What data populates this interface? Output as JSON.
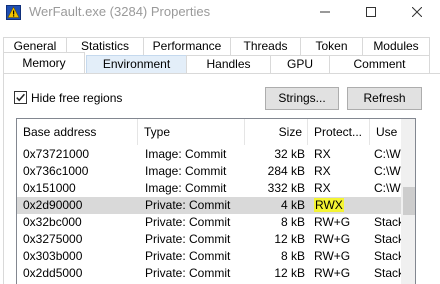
{
  "window": {
    "title": "WerFault.exe (3284) Properties",
    "icon": "werfault-app-icon",
    "controls": {
      "minimize": "minimize-icon",
      "maximize": "maximize-icon",
      "close": "close-icon"
    }
  },
  "tabs": {
    "row1": [
      {
        "label": "General"
      },
      {
        "label": "Statistics"
      },
      {
        "label": "Performance"
      },
      {
        "label": "Threads"
      },
      {
        "label": "Token"
      },
      {
        "label": "Modules"
      }
    ],
    "row2": [
      {
        "label": "Memory",
        "active": true
      },
      {
        "label": "Environment",
        "highlight": true
      },
      {
        "label": "Handles"
      },
      {
        "label": "GPU"
      },
      {
        "label": "Comment"
      }
    ]
  },
  "options": {
    "hide_free_label": "Hide free regions",
    "hide_free_checked": true
  },
  "buttons": {
    "strings": "Strings...",
    "refresh": "Refresh"
  },
  "list": {
    "columns": [
      "Base address",
      "Type",
      "Size",
      "Protect...",
      "Use"
    ],
    "rows": [
      {
        "addr": "0x73721000",
        "type": "Image: Commit",
        "size": "32 kB",
        "protect": "RX",
        "use": "C:\\W"
      },
      {
        "addr": "0x736c1000",
        "type": "Image: Commit",
        "size": "284 kB",
        "protect": "RX",
        "use": "C:\\W"
      },
      {
        "addr": "0x151000",
        "type": "Image: Commit",
        "size": "332 kB",
        "protect": "RX",
        "use": "C:\\W"
      },
      {
        "addr": "0x2d90000",
        "type": "Private: Commit",
        "size": "4 kB",
        "protect": "RWX",
        "use": ""
      },
      {
        "addr": "0x32bc000",
        "type": "Private: Commit",
        "size": "8 kB",
        "protect": "RW+G",
        "use": "Stack"
      },
      {
        "addr": "0x3275000",
        "type": "Private: Commit",
        "size": "12 kB",
        "protect": "RW+G",
        "use": "Stack"
      },
      {
        "addr": "0x303b000",
        "type": "Private: Commit",
        "size": "8 kB",
        "protect": "RW+G",
        "use": "Stack"
      },
      {
        "addr": "0x2dd5000",
        "type": "Private: Commit",
        "size": "12 kB",
        "protect": "RW+G",
        "use": "Stack"
      }
    ],
    "selected_row": 3,
    "highlight_color": "#f4f433"
  }
}
